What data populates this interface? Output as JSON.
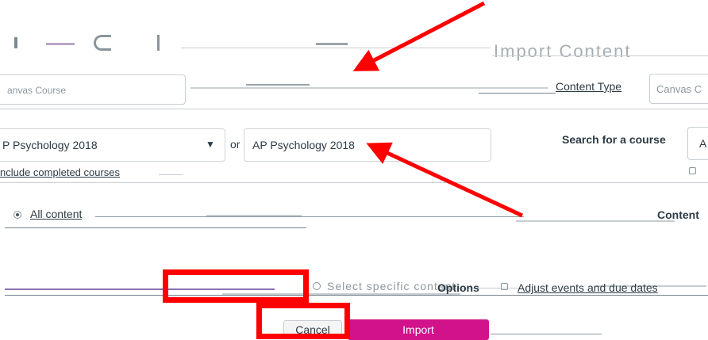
{
  "header": {
    "title_garbled": "Import Content",
    "title_right": "Import Content"
  },
  "content_type": {
    "label": "Content Type",
    "value": "Canvas C",
    "left_value": "anvas Course"
  },
  "course": {
    "selected": "P Psychology 2018",
    "or_label": "or",
    "search_value": "AP Psychology 2018",
    "search_label": "Search for a course",
    "search_partial": "A",
    "include_completed": "nclude completed courses"
  },
  "content": {
    "label": "Content",
    "option_all": "All content",
    "option_specific": "Select specific content"
  },
  "options": {
    "label": "Options",
    "adjust_dates": "Adjust events and due dates"
  },
  "actions": {
    "cancel": "Cancel",
    "import": "Import"
  },
  "annotation_color": "#ff0000",
  "import_color": "#d1128a"
}
